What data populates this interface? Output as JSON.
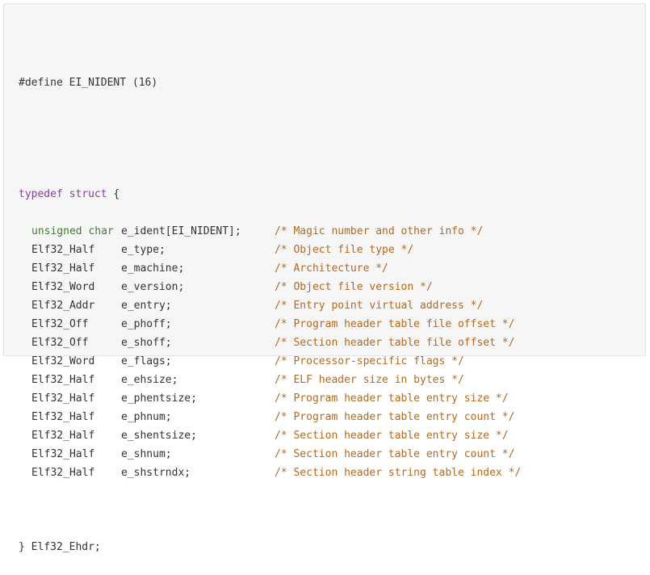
{
  "code_block": {
    "define_line": "#define EI_NIDENT (16)",
    "typedef_keyword": "typedef struct",
    "open_brace": " {",
    "fields": [
      {
        "type": "unsigned char",
        "name": "e_ident[EI_NIDENT];",
        "comment": "/* Magic number and other info */",
        "type_is_keyword": true
      },
      {
        "type": "Elf32_Half",
        "name": "e_type;",
        "comment": "/* Object file type */",
        "type_is_keyword": false
      },
      {
        "type": "Elf32_Half",
        "name": "e_machine;",
        "comment": "/* Architecture */",
        "type_is_keyword": false
      },
      {
        "type": "Elf32_Word",
        "name": "e_version;",
        "comment": "/* Object file version */",
        "type_is_keyword": false
      },
      {
        "type": "Elf32_Addr",
        "name": "e_entry;",
        "comment": "/* Entry point virtual address */",
        "type_is_keyword": false
      },
      {
        "type": "Elf32_Off",
        "name": "e_phoff;",
        "comment": "/* Program header table file offset */",
        "type_is_keyword": false
      },
      {
        "type": "Elf32_Off",
        "name": "e_shoff;",
        "comment": "/* Section header table file offset */",
        "type_is_keyword": false
      },
      {
        "type": "Elf32_Word",
        "name": "e_flags;",
        "comment": "/* Processor-specific flags */",
        "type_is_keyword": false
      },
      {
        "type": "Elf32_Half",
        "name": "e_ehsize;",
        "comment": "/* ELF header size in bytes */",
        "type_is_keyword": false
      },
      {
        "type": "Elf32_Half",
        "name": "e_phentsize;",
        "comment": "/* Program header table entry size */",
        "type_is_keyword": false
      },
      {
        "type": "Elf32_Half",
        "name": "e_phnum;",
        "comment": "/* Program header table entry count */",
        "type_is_keyword": false
      },
      {
        "type": "Elf32_Half",
        "name": "e_shentsize;",
        "comment": "/* Section header table entry size */",
        "type_is_keyword": false
      },
      {
        "type": "Elf32_Half",
        "name": "e_shnum;",
        "comment": "/* Section header table entry count */",
        "type_is_keyword": false
      },
      {
        "type": "Elf32_Half",
        "name": "e_shstrndx;",
        "comment": "/* Section header string table index */",
        "type_is_keyword": false
      }
    ],
    "closing_line": "} Elf32_Ehdr;"
  },
  "colors": {
    "background": "#f6f6f6",
    "border": "#e4e4e4",
    "keyword": "#8a3f9e",
    "type_keyword": "#3f7d2c",
    "comment": "#b3691f",
    "text": "#333333"
  }
}
